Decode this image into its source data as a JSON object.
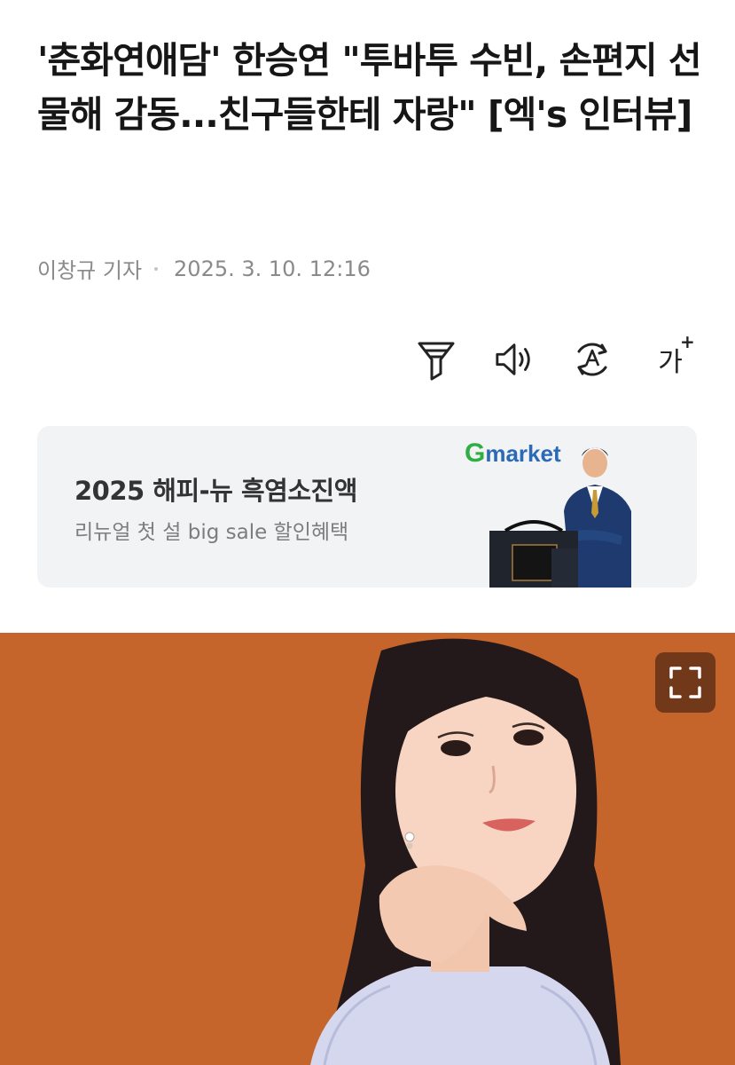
{
  "article": {
    "headline": "'춘화연애담' 한승연 \"투바투 수빈, 손편지 선물해 감동...친구들한테 자랑\" [엑's 인터뷰]",
    "reporter": "이창규 기자",
    "date": "2025. 3. 10. 12:16"
  },
  "toolbar": {
    "font_size_label": "가",
    "font_size_plus": "+",
    "icons": [
      "filter-icon",
      "speaker-icon",
      "translate-icon",
      "font-size-icon"
    ]
  },
  "ad": {
    "title": "2025 해피-뉴 흑염소진액",
    "subtitle": "리뉴얼 첫 설 big sale 할인혜택",
    "brand_g": "G",
    "brand_rest": "market"
  },
  "photo": {
    "background_color": "#c6652b",
    "expand_icon": "expand-icon"
  }
}
